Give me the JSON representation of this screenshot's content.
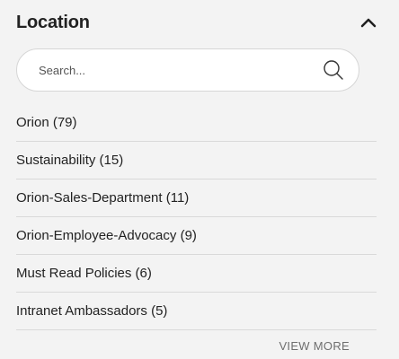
{
  "filter": {
    "title": "Location",
    "collapse_icon": "chevron-up-icon",
    "search": {
      "placeholder": "Search...",
      "value": "",
      "icon": "search-icon"
    },
    "items": [
      {
        "label": "Orion (79)"
      },
      {
        "label": "Sustainability (15)"
      },
      {
        "label": "Orion-Sales-Department (11)"
      },
      {
        "label": "Orion-Employee-Advocacy (9)"
      },
      {
        "label": "Must Read Policies (6)"
      },
      {
        "label": "Intranet Ambassadors (5)"
      }
    ],
    "view_more_label": "VIEW MORE"
  },
  "colors": {
    "background": "#f3f3f3",
    "divider": "#d9d9d9",
    "search_border": "#d6d6d6",
    "muted_text": "#6f6f6f"
  }
}
